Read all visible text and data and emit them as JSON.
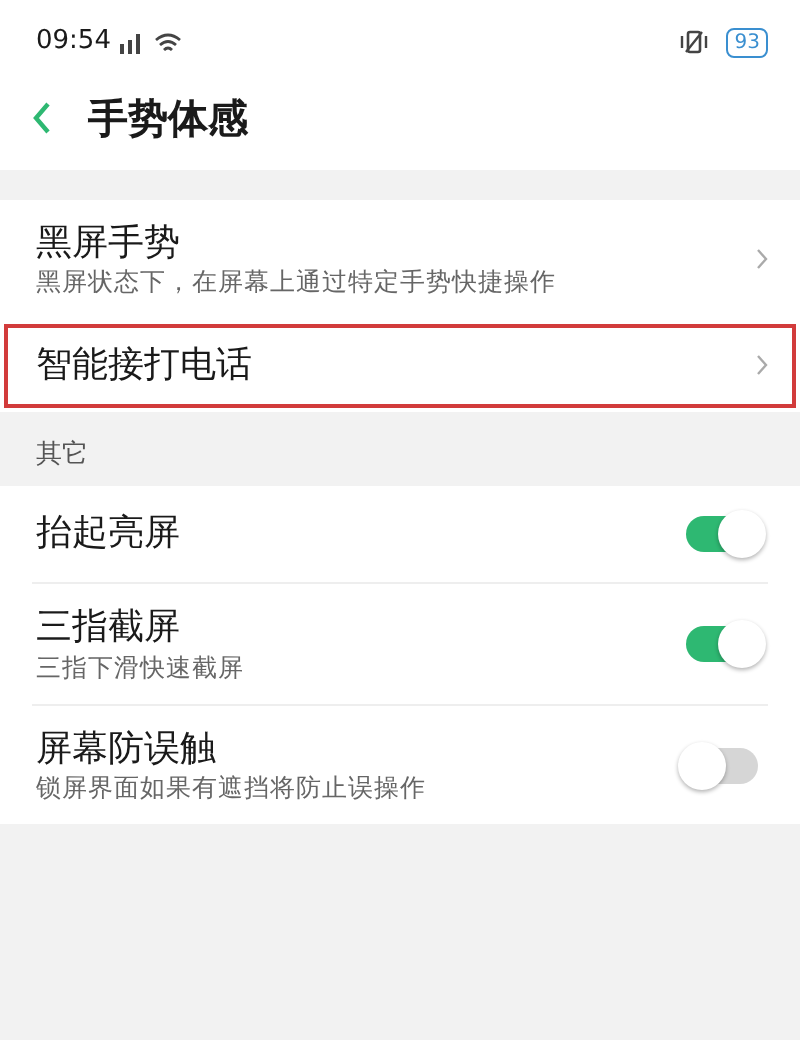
{
  "status_bar": {
    "time": "09:54",
    "battery": "93"
  },
  "header": {
    "title": "手势体感"
  },
  "groups": [
    {
      "items": [
        {
          "kind": "link",
          "title": "黑屏手势",
          "subtitle": "黑屏状态下，在屏幕上通过特定手势快捷操作",
          "highlighted": false
        },
        {
          "kind": "link",
          "title": "智能接打电话",
          "highlighted": true
        }
      ]
    },
    {
      "heading": "其它",
      "items": [
        {
          "kind": "toggle",
          "title": "抬起亮屏",
          "on": true
        },
        {
          "kind": "toggle",
          "title": "三指截屏",
          "subtitle": "三指下滑快速截屏",
          "on": true
        },
        {
          "kind": "toggle",
          "title": "屏幕防误触",
          "subtitle": "锁屏界面如果有遮挡将防止误操作",
          "on": false
        }
      ]
    }
  ]
}
